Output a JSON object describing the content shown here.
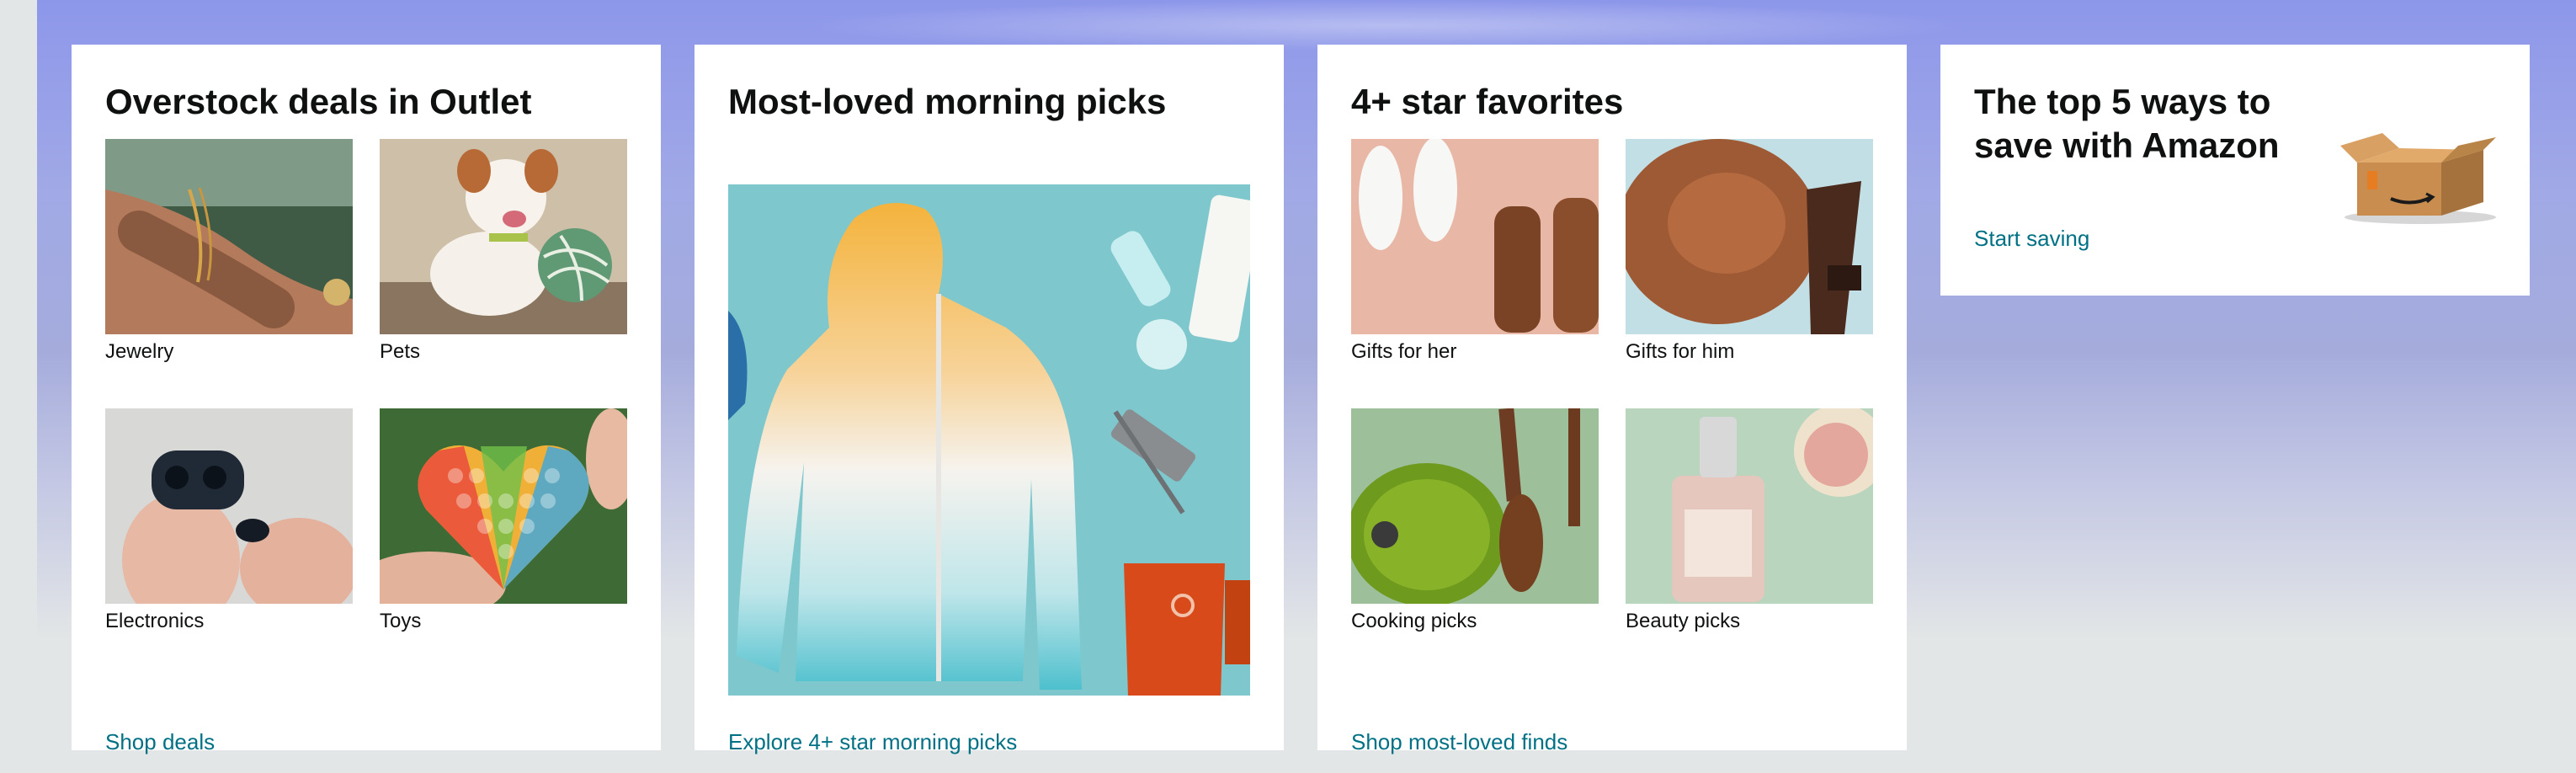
{
  "cards": [
    {
      "title": "Overstock deals in Outlet",
      "tiles": [
        {
          "label": "Jewelry"
        },
        {
          "label": "Pets"
        },
        {
          "label": "Electronics"
        },
        {
          "label": "Toys"
        }
      ],
      "link": "Shop deals"
    },
    {
      "title": "Most-loved morning picks",
      "link": "Explore 4+ star morning picks"
    },
    {
      "title": "4+ star favorites",
      "tiles": [
        {
          "label": "Gifts for her"
        },
        {
          "label": "Gifts for him"
        },
        {
          "label": "Cooking picks"
        },
        {
          "label": "Beauty picks"
        }
      ],
      "link": "Shop most-loved finds"
    },
    {
      "title": "The top 5 ways to save with Amazon",
      "link": "Start saving"
    }
  ]
}
